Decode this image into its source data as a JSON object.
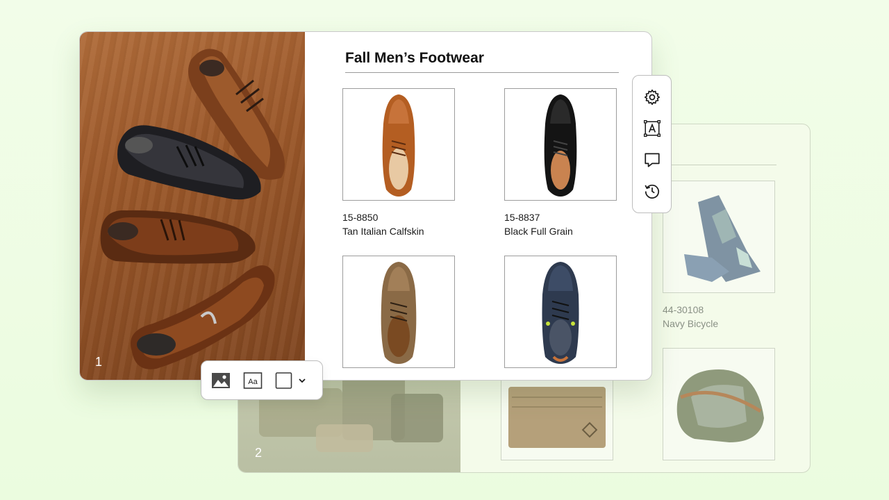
{
  "front_page": {
    "title": "Fall Men’s Footwear",
    "page_number": "1",
    "products": [
      {
        "code": "15-8850",
        "name": "Tan Italian Calfskin",
        "icon": "tan-oxford-shoe"
      },
      {
        "code": "15-8837",
        "name": "Black Full Grain",
        "icon": "black-oxford-shoe"
      },
      {
        "icon": "tan-chukka-shoe"
      },
      {
        "icon": "navy-knit-sneaker"
      }
    ]
  },
  "back_page": {
    "page_number": "2",
    "products": [
      {
        "code": "44-30108",
        "name": "Navy Bicycle",
        "icon": "argyle-socks"
      },
      {
        "icon": "leather-wallet"
      },
      {
        "icon": "canvas-dopp-kit"
      }
    ]
  },
  "side_toolbar": {
    "buttons": [
      "gear-icon",
      "text-frame-icon",
      "comment-icon",
      "history-icon"
    ]
  },
  "insert_toolbar": {
    "buttons": [
      "image-icon",
      "text-icon",
      "shape-icon",
      "chevron-down-icon"
    ]
  },
  "colors": {
    "background": "#eefcdf",
    "card": "#ffffff",
    "back_card": "#f4fbea",
    "text": "#111111",
    "muted_text": "#8a9186"
  }
}
